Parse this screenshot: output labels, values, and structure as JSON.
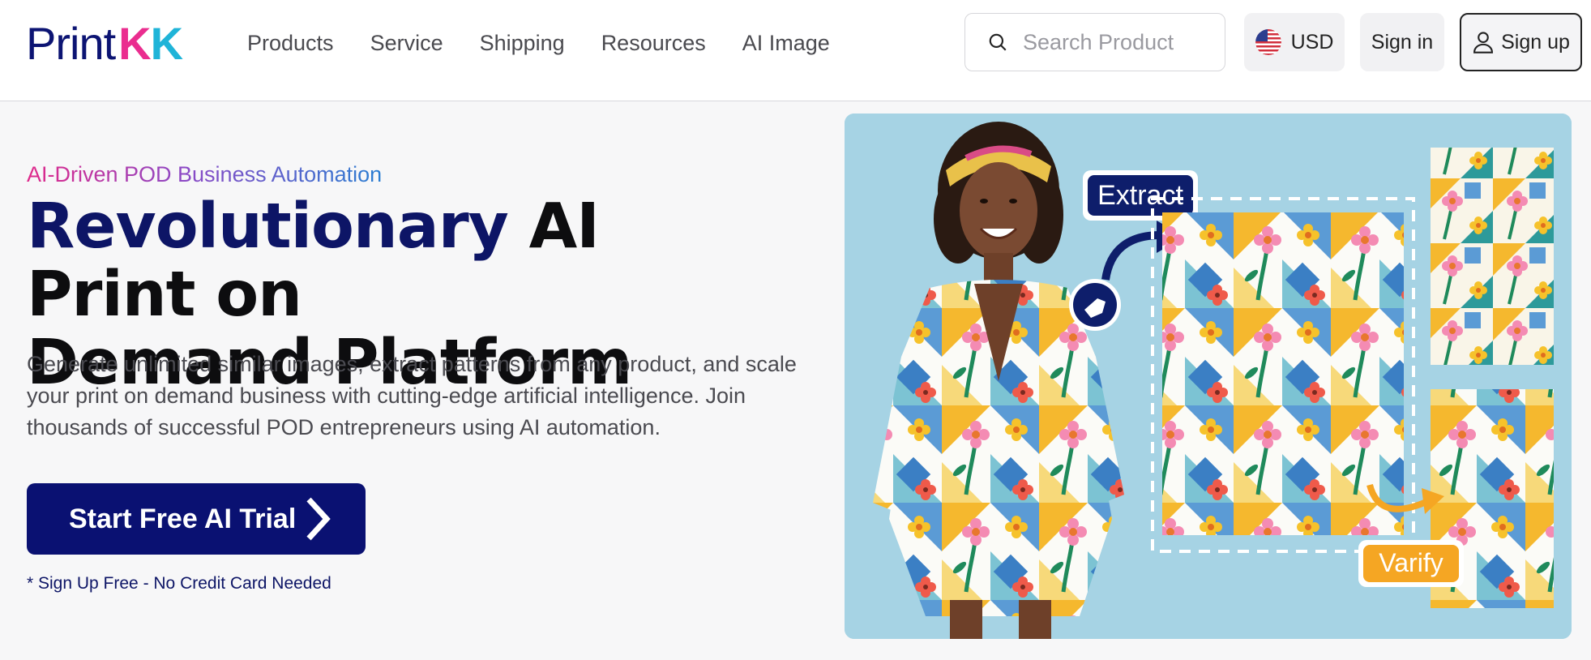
{
  "brand": {
    "logo_text_main": "Print",
    "logo_text_k1": "K",
    "logo_text_k2": "K"
  },
  "nav": {
    "items": [
      "Products",
      "Service",
      "Shipping",
      "Resources",
      "AI Image"
    ]
  },
  "search": {
    "placeholder": "Search Product",
    "icon": "search-icon"
  },
  "currency": {
    "label": "USD",
    "icon": "us-flag-icon"
  },
  "auth": {
    "signin_label": "Sign in",
    "signup_label": "Sign up",
    "signup_icon": "user-icon"
  },
  "hero": {
    "eyebrow": "AI-Driven POD Business Automation",
    "headline_accent": "Revolutionary",
    "headline_rest_line1": " AI Print on",
    "headline_line2": "Demand Platform",
    "description": "Generate unlimited similar images, extract patterns from any product, and scale your print on demand business with cutting-edge artificial intelligence. Join thousands of successful POD entrepreneurs using AI automation.",
    "cta_label": "Start Free AI Trial",
    "cta_icon": "chevron-right-icon",
    "note": "* Sign Up Free - No Credit Card Needed"
  },
  "illustration": {
    "extract_label": "Extract",
    "varify_label": "Varify",
    "hand_icon": "hand-pointer-icon"
  },
  "colors": {
    "brand_navy": "#0a1172",
    "accent_pink": "#ea2d8f",
    "accent_orange": "#f3a61b",
    "accent_cyan": "#1fb4d8",
    "badge_orange": "#f5a623",
    "image_bg": "#a6d3e4"
  }
}
